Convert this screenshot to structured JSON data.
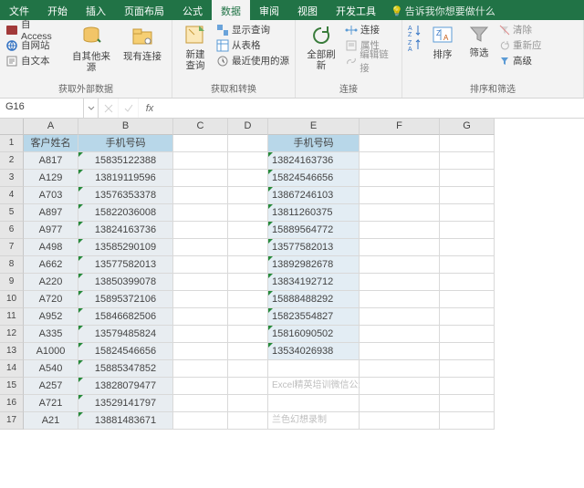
{
  "tabs": {
    "file": "文件",
    "home": "开始",
    "insert": "插入",
    "layout": "页面布局",
    "formulas": "公式",
    "data": "数据",
    "review": "审阅",
    "view": "视图",
    "developer": "开发工具",
    "tellme": "告诉我你想要做什么"
  },
  "ribbon": {
    "ext": {
      "access": "自 Access",
      "web": "自网站",
      "text": "自文本",
      "other": "自其他来源",
      "existing": "现有连接",
      "label": "获取外部数据"
    },
    "query": {
      "new": "新建\n查询",
      "show": "显示查询",
      "table": "从表格",
      "recent": "最近使用的源",
      "label": "获取和转换"
    },
    "conn": {
      "refresh": "全部刷新",
      "connections": "连接",
      "properties": "属性",
      "editlinks": "编辑链接",
      "label": "连接"
    },
    "sort": {
      "sort": "排序",
      "filter": "筛选",
      "clear": "清除",
      "reapply": "重新应",
      "advanced": "高级",
      "label": "排序和筛选"
    }
  },
  "namebox": "G16",
  "columns": [
    "A",
    "B",
    "C",
    "D",
    "E",
    "F",
    "G"
  ],
  "headerRow": {
    "a": "客户姓名",
    "b": "手机号码",
    "e": "手机号码"
  },
  "tableAB": [
    [
      "A817",
      "15835122388"
    ],
    [
      "A129",
      "13819119596"
    ],
    [
      "A703",
      "13576353378"
    ],
    [
      "A897",
      "15822036008"
    ],
    [
      "A977",
      "13824163736"
    ],
    [
      "A498",
      "13585290109"
    ],
    [
      "A662",
      "13577582013"
    ],
    [
      "A220",
      "13850399078"
    ],
    [
      "A720",
      "15895372106"
    ],
    [
      "A952",
      "15846682506"
    ],
    [
      "A335",
      "13579485824"
    ],
    [
      "A1000",
      "15824546656"
    ],
    [
      "A540",
      "15885347852"
    ],
    [
      "A257",
      "13828079477"
    ],
    [
      "A721",
      "13529141797"
    ],
    [
      "A21",
      "13881483671"
    ]
  ],
  "tableE": [
    "13824163736",
    "15824546656",
    "13867246103",
    "13811260375",
    "15889564772",
    "13577582013",
    "13892982678",
    "13834192712",
    "15888488292",
    "15823554827",
    "15816090502",
    "13534026938"
  ],
  "watermark": {
    "line1": "Excel精英培训微信公众号出品",
    "line2": "兰色幻想录制"
  }
}
